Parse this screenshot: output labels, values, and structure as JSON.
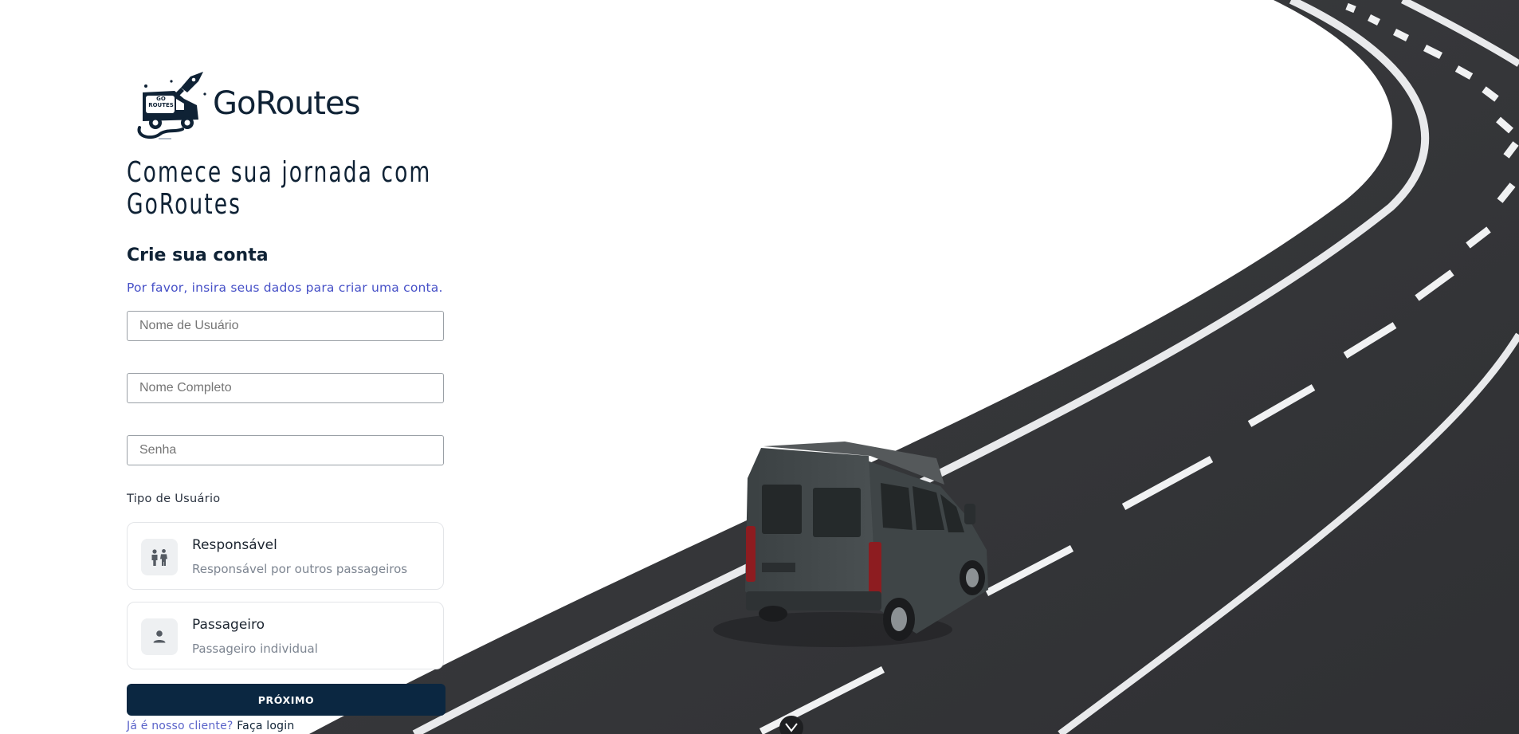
{
  "brand": {
    "name": "GoRoutes",
    "logo_badge": "GO ROUTES"
  },
  "headline": {
    "line1": "Comece sua jornada com",
    "line2": "GoRoutes"
  },
  "form": {
    "title": "Crie sua conta",
    "subtitle": "Por favor, insira seus dados para criar uma conta.",
    "username_placeholder": "Nome de Usuário",
    "fullname_placeholder": "Nome Completo",
    "password_placeholder": "Senha",
    "user_type_label": "Tipo de Usuário",
    "options": [
      {
        "title": "Responsável",
        "description": "Responsável por outros passageiros",
        "icon": "family-icon"
      },
      {
        "title": "Passageiro",
        "description": "Passageiro individual",
        "icon": "person-icon"
      }
    ],
    "next_button": "PRÓXIMO",
    "login_question": "Já é nosso cliente?",
    "login_link": "Faça login"
  },
  "colors": {
    "primary": "#0b2741",
    "accent_text": "#4650c7",
    "road": "#3a3b3d",
    "van": "#3d4244"
  }
}
